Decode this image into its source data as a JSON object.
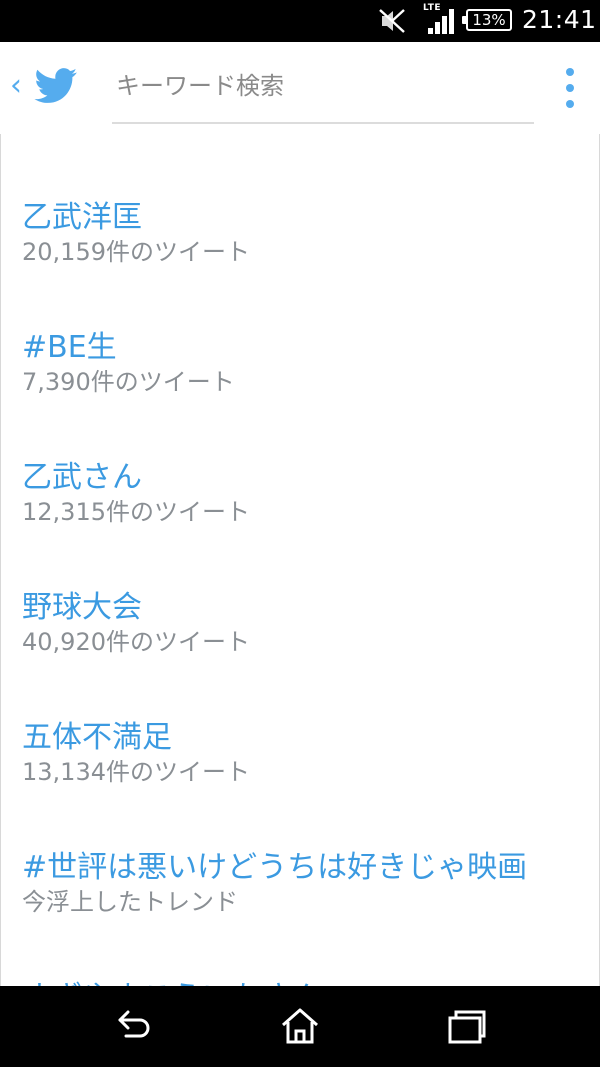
{
  "status_bar": {
    "network": "LTE",
    "battery": "13%",
    "time": "21:41",
    "icons": [
      "mute-icon",
      "signal-icon",
      "battery-icon"
    ]
  },
  "toolbar": {
    "back_glyph": "‹",
    "search_placeholder": "キーワード検索",
    "search_value": "",
    "icons": [
      "chevron-left-icon",
      "twitter-bird-icon",
      "overflow-menu-icon"
    ]
  },
  "trends": [
    {
      "title": "乙武洋匡",
      "subtitle": "20,159件のツイート"
    },
    {
      "title": "#BE生",
      "subtitle": "7,390件のツイート"
    },
    {
      "title": "乙武さん",
      "subtitle": "12,315件のツイート"
    },
    {
      "title": "野球大会",
      "subtitle": "40,920件のツイート"
    },
    {
      "title": "五体不満足",
      "subtitle": "13,134件のツイート"
    },
    {
      "title": "#世評は悪いけどうちは好きじゃ映画",
      "subtitle": "今浮上したトレンド"
    },
    {
      "title": "すぎやまこういちさん",
      "subtitle": ""
    }
  ],
  "nav_bar": {
    "icons": [
      "back-icon",
      "home-icon",
      "recents-icon"
    ]
  },
  "colors": {
    "accent": "#55acee",
    "trend_title": "#3b9ae1",
    "trend_subtitle": "#8a8f94",
    "status_bar_bg": "#000000",
    "nav_bar_bg": "#000000"
  }
}
